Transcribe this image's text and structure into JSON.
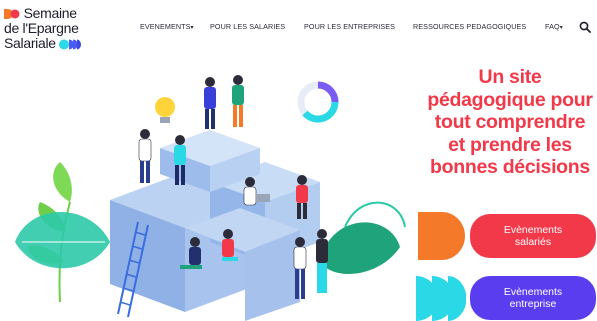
{
  "logo": {
    "line1": "Semaine",
    "line2": "de l'Epargne",
    "line3": "Salariale"
  },
  "nav": {
    "items": [
      {
        "label": "EVENEMENTS",
        "has_dropdown": true
      },
      {
        "label": "POUR LES SALARIES",
        "has_dropdown": false
      },
      {
        "label": "POUR LES ENTREPRISES",
        "has_dropdown": false
      },
      {
        "label": "RESSOURCES PEDAGOGIQUES",
        "has_dropdown": false
      },
      {
        "label": "FAQ",
        "has_dropdown": true
      }
    ],
    "caret": "▾",
    "search_icon": "search-icon"
  },
  "hero": {
    "headline_lines": [
      "Un site",
      "pédagogique pour",
      "tout comprendre",
      "et prendre les",
      "bonnes décisions"
    ],
    "buttons": [
      {
        "line1": "Evènements",
        "line2": "salariés",
        "color": "#f2394a"
      },
      {
        "line1": "Evènements",
        "line2": "entreprise",
        "color": "#5b3df0"
      }
    ]
  },
  "colors": {
    "accent_red": "#f2394a",
    "accent_orange": "#f47a2a",
    "accent_blue": "#4a5cf5",
    "accent_cyan": "#2ad8e6",
    "text_dark": "#1d1d2b"
  }
}
